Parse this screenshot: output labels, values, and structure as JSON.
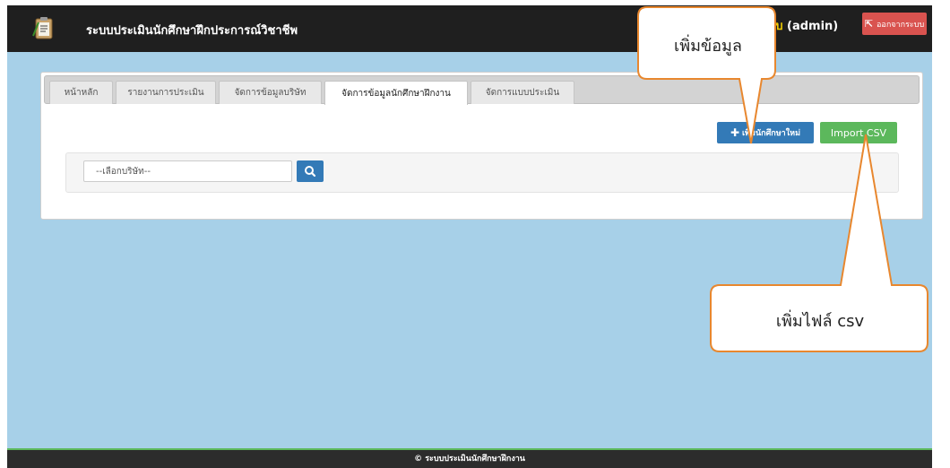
{
  "app": {
    "title": "ระบบประเมินนักศึกษาฝึกประการณ์วิชาชีพ",
    "user_prefix": "ระบบ",
    "user_role": "(admin)",
    "logout_label": "ออกจากระบบ",
    "brand_icon": "clipboard-icon"
  },
  "tabs": [
    {
      "label": "หน้าหลัก",
      "active": false
    },
    {
      "label": "รายงานการประเมิน",
      "active": false
    },
    {
      "label": "จัดการข้อมูลบริษัท",
      "active": false
    },
    {
      "label": "จัดการข้อมูลนักศึกษาฝึกงาน",
      "active": true
    },
    {
      "label": "จัดการแบบประเมิน",
      "active": false
    }
  ],
  "actions": {
    "add_student_label": "เพิ่มนักศึกษาใหม่",
    "import_csv_label": "Import CSV"
  },
  "filter": {
    "company_placeholder": "--เลือกบริษัท--"
  },
  "callouts": {
    "add_data": "เพิ่มข้อมูล",
    "add_csv": "เพิ่มไฟล์ csv"
  },
  "footer": {
    "text": "© ระบบประเมินนักศึกษาฝึกงาน"
  },
  "colors": {
    "navbar": "#1f1f1f",
    "content_bg": "#a7d0e8",
    "primary": "#337ab7",
    "success": "#5cb85c",
    "danger": "#d9534f",
    "callout_border": "#e8872e"
  }
}
